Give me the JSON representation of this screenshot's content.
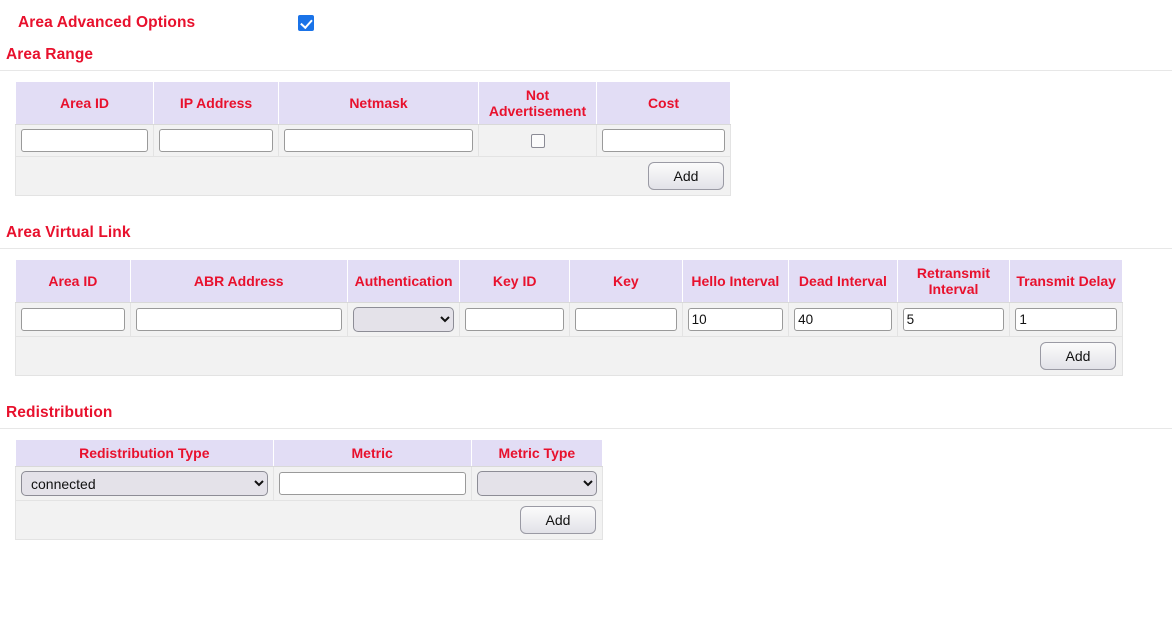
{
  "advanced": {
    "label": "Area Advanced Options",
    "checked": true,
    "accent_color": "#e8112d",
    "checkbox_color": "#1a73e8"
  },
  "area_range": {
    "title": "Area Range",
    "columns": [
      "Area ID",
      "IP Address",
      "Netmask",
      "Not Advertisement",
      "Cost"
    ],
    "row": {
      "area_id": "",
      "ip_address": "",
      "netmask": "",
      "not_advertisement": false,
      "cost": ""
    },
    "add_label": "Add"
  },
  "area_virtual_link": {
    "title": "Area Virtual Link",
    "columns": [
      "Area ID",
      "ABR Address",
      "Authentication",
      "Key ID",
      "Key",
      "Hello Interval",
      "Dead Interval",
      "Retransmit Interval",
      "Transmit Delay"
    ],
    "row": {
      "area_id": "",
      "abr_address": "",
      "authentication": "",
      "authentication_options": [
        ""
      ],
      "key_id": "",
      "key": "",
      "hello_interval": "10",
      "dead_interval": "40",
      "retransmit_interval": "5",
      "transmit_delay": "1"
    },
    "add_label": "Add"
  },
  "redistribution": {
    "title": "Redistribution",
    "columns": [
      "Redistribution Type",
      "Metric",
      "Metric Type"
    ],
    "row": {
      "redistribution_type": "connected",
      "redistribution_type_options": [
        "connected"
      ],
      "metric": "",
      "metric_type": "",
      "metric_type_options": [
        ""
      ]
    },
    "add_label": "Add"
  }
}
